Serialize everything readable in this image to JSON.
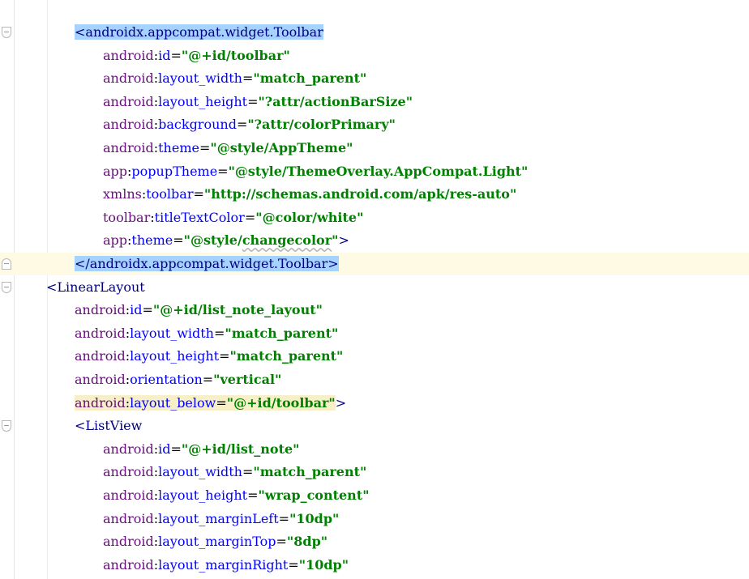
{
  "lines": [
    {
      "indent": 92,
      "fold": "down",
      "tokens": [
        {
          "t": "<androidx.appcompat.widget.Toolbar",
          "c": "tag",
          "sel": true
        }
      ]
    },
    {
      "indent": 127,
      "tokens": [
        {
          "t": "android",
          "c": "ns"
        },
        {
          "t": ":",
          "c": "punct"
        },
        {
          "t": "id",
          "c": "attr"
        },
        {
          "t": "=",
          "c": "punct"
        },
        {
          "t": "\"@+id/toolbar\"",
          "c": "val"
        }
      ]
    },
    {
      "indent": 127,
      "tokens": [
        {
          "t": "android",
          "c": "ns"
        },
        {
          "t": ":",
          "c": "punct"
        },
        {
          "t": "layout_width",
          "c": "attr"
        },
        {
          "t": "=",
          "c": "punct"
        },
        {
          "t": "\"match_parent\"",
          "c": "val"
        }
      ]
    },
    {
      "indent": 127,
      "tokens": [
        {
          "t": "android",
          "c": "ns"
        },
        {
          "t": ":",
          "c": "punct"
        },
        {
          "t": "layout_height",
          "c": "attr"
        },
        {
          "t": "=",
          "c": "punct"
        },
        {
          "t": "\"?attr/actionBarSize\"",
          "c": "val"
        }
      ]
    },
    {
      "indent": 127,
      "tokens": [
        {
          "t": "android",
          "c": "ns"
        },
        {
          "t": ":",
          "c": "punct"
        },
        {
          "t": "background",
          "c": "attr"
        },
        {
          "t": "=",
          "c": "punct"
        },
        {
          "t": "\"?attr/colorPrimary\"",
          "c": "val"
        }
      ]
    },
    {
      "indent": 127,
      "tokens": [
        {
          "t": "android",
          "c": "ns"
        },
        {
          "t": ":",
          "c": "punct"
        },
        {
          "t": "theme",
          "c": "attr"
        },
        {
          "t": "=",
          "c": "punct"
        },
        {
          "t": "\"@style/AppTheme\"",
          "c": "val"
        }
      ]
    },
    {
      "indent": 127,
      "tokens": [
        {
          "t": "app",
          "c": "ns"
        },
        {
          "t": ":",
          "c": "punct"
        },
        {
          "t": "popupTheme",
          "c": "attr"
        },
        {
          "t": "=",
          "c": "punct"
        },
        {
          "t": "\"@style/ThemeOverlay.AppCompat.Light\"",
          "c": "val"
        }
      ]
    },
    {
      "indent": 127,
      "tokens": [
        {
          "t": "xmlns",
          "c": "ns"
        },
        {
          "t": ":",
          "c": "punct"
        },
        {
          "t": "toolbar",
          "c": "attr"
        },
        {
          "t": "=",
          "c": "punct"
        },
        {
          "t": "\"http://schemas.android.com/apk/res-auto\"",
          "c": "val"
        }
      ]
    },
    {
      "indent": 127,
      "tokens": [
        {
          "t": "toolbar",
          "c": "ns"
        },
        {
          "t": ":",
          "c": "punct"
        },
        {
          "t": "titleTextColor",
          "c": "attr"
        },
        {
          "t": "=",
          "c": "punct"
        },
        {
          "t": "\"@color/white\"",
          "c": "val"
        }
      ]
    },
    {
      "indent": 127,
      "tokens": [
        {
          "t": "app",
          "c": "ns"
        },
        {
          "t": ":",
          "c": "punct"
        },
        {
          "t": "theme",
          "c": "attr"
        },
        {
          "t": "=",
          "c": "punct"
        },
        {
          "t": "\"@style/",
          "c": "val"
        },
        {
          "t": "changecolor",
          "c": "val",
          "squiggle": true
        },
        {
          "t": "\"",
          "c": "val"
        },
        {
          "t": ">",
          "c": "tag"
        }
      ]
    },
    {
      "indent": 92,
      "fold": "up",
      "current": true,
      "tokens": [
        {
          "t": "</androidx.appcompat.widget.Toolbar>",
          "c": "tag",
          "sel": true
        }
      ]
    },
    {
      "indent": 57,
      "fold": "down",
      "tokens": [
        {
          "t": "<LinearLayout",
          "c": "tag"
        }
      ]
    },
    {
      "indent": 92,
      "tokens": [
        {
          "t": "android",
          "c": "ns"
        },
        {
          "t": ":",
          "c": "punct"
        },
        {
          "t": "id",
          "c": "attr"
        },
        {
          "t": "=",
          "c": "punct"
        },
        {
          "t": "\"@+id/list_note_layout\"",
          "c": "val"
        }
      ]
    },
    {
      "indent": 92,
      "tokens": [
        {
          "t": "android",
          "c": "ns"
        },
        {
          "t": ":",
          "c": "punct"
        },
        {
          "t": "layout_width",
          "c": "attr"
        },
        {
          "t": "=",
          "c": "punct"
        },
        {
          "t": "\"match_parent\"",
          "c": "val"
        }
      ]
    },
    {
      "indent": 92,
      "tokens": [
        {
          "t": "android",
          "c": "ns"
        },
        {
          "t": ":",
          "c": "punct"
        },
        {
          "t": "layout_height",
          "c": "attr"
        },
        {
          "t": "=",
          "c": "punct"
        },
        {
          "t": "\"match_parent\"",
          "c": "val"
        }
      ]
    },
    {
      "indent": 92,
      "tokens": [
        {
          "t": "android",
          "c": "ns"
        },
        {
          "t": ":",
          "c": "punct"
        },
        {
          "t": "orientation",
          "c": "attr"
        },
        {
          "t": "=",
          "c": "punct"
        },
        {
          "t": "\"vertical\"",
          "c": "val"
        }
      ]
    },
    {
      "indent": 92,
      "tokens": [
        {
          "t": "android",
          "c": "ns",
          "hl": true
        },
        {
          "t": ":",
          "c": "punct",
          "hl": true
        },
        {
          "t": "layout_below",
          "c": "attr",
          "hl": true
        },
        {
          "t": "=",
          "c": "punct",
          "hl": true
        },
        {
          "t": "\"@+id/toolbar\"",
          "c": "val",
          "hl": true
        },
        {
          "t": ">",
          "c": "tag"
        }
      ]
    },
    {
      "indent": 92,
      "fold": "down",
      "tokens": [
        {
          "t": "<ListView",
          "c": "tag"
        }
      ]
    },
    {
      "indent": 127,
      "tokens": [
        {
          "t": "android",
          "c": "ns"
        },
        {
          "t": ":",
          "c": "punct"
        },
        {
          "t": "id",
          "c": "attr"
        },
        {
          "t": "=",
          "c": "punct"
        },
        {
          "t": "\"@+id/list_note\"",
          "c": "val"
        }
      ]
    },
    {
      "indent": 127,
      "tokens": [
        {
          "t": "android",
          "c": "ns"
        },
        {
          "t": ":",
          "c": "punct"
        },
        {
          "t": "layout_width",
          "c": "attr"
        },
        {
          "t": "=",
          "c": "punct"
        },
        {
          "t": "\"match_parent\"",
          "c": "val"
        }
      ]
    },
    {
      "indent": 127,
      "tokens": [
        {
          "t": "android",
          "c": "ns"
        },
        {
          "t": ":",
          "c": "punct"
        },
        {
          "t": "layout_height",
          "c": "attr"
        },
        {
          "t": "=",
          "c": "punct"
        },
        {
          "t": "\"wrap_content\"",
          "c": "val"
        }
      ]
    },
    {
      "indent": 127,
      "tokens": [
        {
          "t": "android",
          "c": "ns"
        },
        {
          "t": ":",
          "c": "punct"
        },
        {
          "t": "layout_marginLeft",
          "c": "attr"
        },
        {
          "t": "=",
          "c": "punct"
        },
        {
          "t": "\"10dp\"",
          "c": "val"
        }
      ]
    },
    {
      "indent": 127,
      "tokens": [
        {
          "t": "android",
          "c": "ns"
        },
        {
          "t": ":",
          "c": "punct"
        },
        {
          "t": "layout_marginTop",
          "c": "attr"
        },
        {
          "t": "=",
          "c": "punct"
        },
        {
          "t": "\"8dp\"",
          "c": "val"
        }
      ]
    },
    {
      "indent": 127,
      "tokens": [
        {
          "t": "android",
          "c": "ns"
        },
        {
          "t": ":",
          "c": "punct"
        },
        {
          "t": "layout_marginRight",
          "c": "attr"
        },
        {
          "t": "=",
          "c": "punct"
        },
        {
          "t": "\"10dp\"",
          "c": "val"
        }
      ]
    }
  ]
}
